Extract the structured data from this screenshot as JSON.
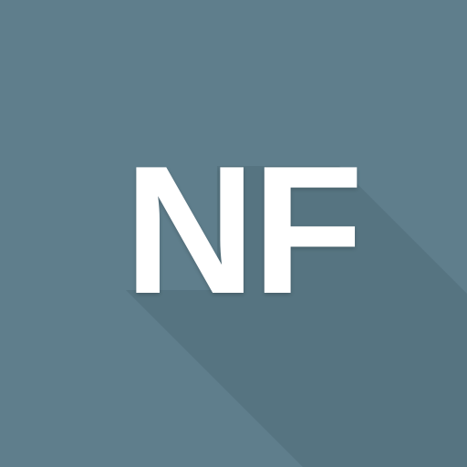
{
  "app_icon": {
    "monogram": "NF",
    "background_color": "#5f7e8c",
    "text_color": "#ffffff",
    "shadow_color": "#4f6c79"
  }
}
